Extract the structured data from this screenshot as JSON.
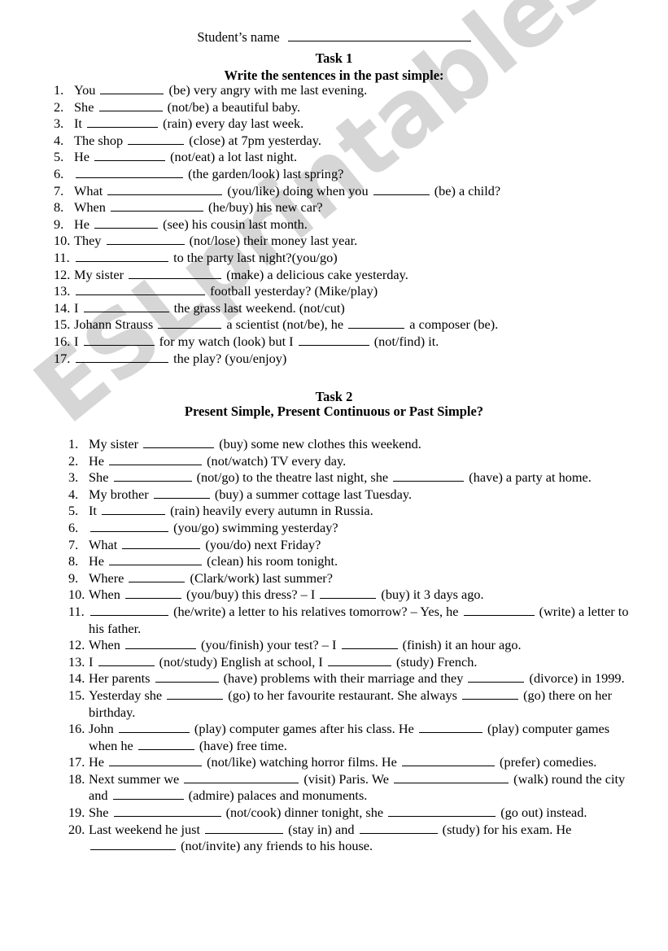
{
  "header": {
    "student_name_label": "Student’s name",
    "student_name_value": ""
  },
  "task1": {
    "title": "Task 1",
    "subtitle": "Write the sentences in the past simple:",
    "items": [
      {
        "n": "1.",
        "text": "You ________ (be) very angry with me last evening."
      },
      {
        "n": "2.",
        "text": "She ________ (not/be) a beautiful baby."
      },
      {
        "n": "3.",
        "text": "It _________ (rain) every day last week."
      },
      {
        "n": "4.",
        "text": "The shop _______ (close) at 7pm yesterday."
      },
      {
        "n": "5.",
        "text": "He _________ (not/eat) a lot last night."
      },
      {
        "n": "6.",
        "text": "______________ (the garden/look) last spring?"
      },
      {
        "n": "7.",
        "text": "What _______________ (you/like) doing when you _______ (be) a child?"
      },
      {
        "n": "8.",
        "text": "When ____________ (he/buy) his new car?"
      },
      {
        "n": "9.",
        "text": "He ________ (see) his cousin last month."
      },
      {
        "n": "10.",
        "text": "They __________ (not/lose) their money last year."
      },
      {
        "n": "11.",
        "text": "____________ to the party last night?(you/go)"
      },
      {
        "n": "12.",
        "text": "My sister ____________ (make) a delicious cake yesterday."
      },
      {
        "n": "13.",
        "text": "_________________ football yesterday? (Mike/play)"
      },
      {
        "n": "14.",
        "text": "I ___________ the grass last weekend. (not/cut)"
      },
      {
        "n": "15.",
        "text": "Johann Strauss ________ a scientist (not/be), he _______ a composer (be)."
      },
      {
        "n": "16.",
        "text": "I _________ for my watch (look) but I _________ (not/find) it."
      },
      {
        "n": "17.",
        "text": "____________ the play? (you/enjoy)"
      }
    ]
  },
  "task2": {
    "title": "Task 2",
    "subtitle": "Present Simple, Present Continuous or Past Simple?",
    "items": [
      {
        "n": "1.",
        "text": "My sister _________ (buy) some new clothes this weekend."
      },
      {
        "n": "2.",
        "text": "He ____________ (not/watch) TV every day."
      },
      {
        "n": "3.",
        "text": "She __________ (not/go) to the theatre last night, she _________ (have) a party at home."
      },
      {
        "n": "4.",
        "text": "My brother _______ (buy) a summer cottage last Tuesday."
      },
      {
        "n": "5.",
        "text": "It ________ (rain) heavily every autumn in Russia."
      },
      {
        "n": "6.",
        "text": "__________ (you/go) swimming yesterday?"
      },
      {
        "n": "7.",
        "text": "What __________ (you/do) next Friday?"
      },
      {
        "n": "8.",
        "text": "He ____________ (clean) his room tonight."
      },
      {
        "n": "9.",
        "text": "Where _______ (Clark/work) last summer?"
      },
      {
        "n": "10.",
        "text": "When _______ (you/buy) this dress? – I _______ (buy) it 3 days ago."
      },
      {
        "n": "11.",
        "text": "__________ (he/write) a letter to his relatives tomorrow? – Yes, he _________ (write) a letter to his father."
      },
      {
        "n": "12.",
        "text": "When _________ (you/finish) your test? – I _______ (finish) it an hour ago."
      },
      {
        "n": "13.",
        "text": "I _______ (not/study) English at school, I ________ (study) French."
      },
      {
        "n": "14.",
        "text": "Her parents ________ (have) problems with their marriage and they _______ (divorce) in 1999."
      },
      {
        "n": "15.",
        "text": "Yesterday she _______ (go) to her favourite restaurant. She always _______ (go) there on her birthday."
      },
      {
        "n": "16.",
        "text": "John _________ (play) computer games after his class. He ________ (play) computer games when he _______ (have) free time."
      },
      {
        "n": "17.",
        "text": "He ____________ (not/like) watching horror films. He ____________ (prefer) comedies."
      },
      {
        "n": "18.",
        "text": "Next summer we _______________ (visit) Paris. We _______________ (walk) round the city and _________ (admire) palaces and monuments."
      },
      {
        "n": "19.",
        "text": "She ______________ (not/cook) dinner tonight, she ______________ (go out) instead."
      },
      {
        "n": "20.",
        "text": "Last weekend he just __________ (stay in) and __________ (study) for his exam. He ___________ (not/invite) any friends to his house."
      }
    ]
  },
  "watermark": {
    "text": "ESLprintables.com",
    "color": "#d6d6d6"
  }
}
